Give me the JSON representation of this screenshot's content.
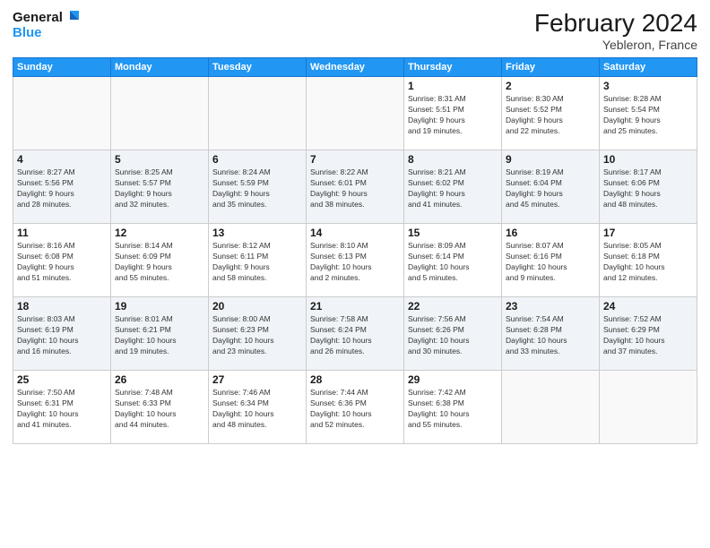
{
  "logo": {
    "line1": "General",
    "line2": "Blue"
  },
  "title": "February 2024",
  "location": "Yebleron, France",
  "days_of_week": [
    "Sunday",
    "Monday",
    "Tuesday",
    "Wednesday",
    "Thursday",
    "Friday",
    "Saturday"
  ],
  "weeks": [
    [
      {
        "day": "",
        "info": ""
      },
      {
        "day": "",
        "info": ""
      },
      {
        "day": "",
        "info": ""
      },
      {
        "day": "",
        "info": ""
      },
      {
        "day": "1",
        "info": "Sunrise: 8:31 AM\nSunset: 5:51 PM\nDaylight: 9 hours\nand 19 minutes."
      },
      {
        "day": "2",
        "info": "Sunrise: 8:30 AM\nSunset: 5:52 PM\nDaylight: 9 hours\nand 22 minutes."
      },
      {
        "day": "3",
        "info": "Sunrise: 8:28 AM\nSunset: 5:54 PM\nDaylight: 9 hours\nand 25 minutes."
      }
    ],
    [
      {
        "day": "4",
        "info": "Sunrise: 8:27 AM\nSunset: 5:56 PM\nDaylight: 9 hours\nand 28 minutes."
      },
      {
        "day": "5",
        "info": "Sunrise: 8:25 AM\nSunset: 5:57 PM\nDaylight: 9 hours\nand 32 minutes."
      },
      {
        "day": "6",
        "info": "Sunrise: 8:24 AM\nSunset: 5:59 PM\nDaylight: 9 hours\nand 35 minutes."
      },
      {
        "day": "7",
        "info": "Sunrise: 8:22 AM\nSunset: 6:01 PM\nDaylight: 9 hours\nand 38 minutes."
      },
      {
        "day": "8",
        "info": "Sunrise: 8:21 AM\nSunset: 6:02 PM\nDaylight: 9 hours\nand 41 minutes."
      },
      {
        "day": "9",
        "info": "Sunrise: 8:19 AM\nSunset: 6:04 PM\nDaylight: 9 hours\nand 45 minutes."
      },
      {
        "day": "10",
        "info": "Sunrise: 8:17 AM\nSunset: 6:06 PM\nDaylight: 9 hours\nand 48 minutes."
      }
    ],
    [
      {
        "day": "11",
        "info": "Sunrise: 8:16 AM\nSunset: 6:08 PM\nDaylight: 9 hours\nand 51 minutes."
      },
      {
        "day": "12",
        "info": "Sunrise: 8:14 AM\nSunset: 6:09 PM\nDaylight: 9 hours\nand 55 minutes."
      },
      {
        "day": "13",
        "info": "Sunrise: 8:12 AM\nSunset: 6:11 PM\nDaylight: 9 hours\nand 58 minutes."
      },
      {
        "day": "14",
        "info": "Sunrise: 8:10 AM\nSunset: 6:13 PM\nDaylight: 10 hours\nand 2 minutes."
      },
      {
        "day": "15",
        "info": "Sunrise: 8:09 AM\nSunset: 6:14 PM\nDaylight: 10 hours\nand 5 minutes."
      },
      {
        "day": "16",
        "info": "Sunrise: 8:07 AM\nSunset: 6:16 PM\nDaylight: 10 hours\nand 9 minutes."
      },
      {
        "day": "17",
        "info": "Sunrise: 8:05 AM\nSunset: 6:18 PM\nDaylight: 10 hours\nand 12 minutes."
      }
    ],
    [
      {
        "day": "18",
        "info": "Sunrise: 8:03 AM\nSunset: 6:19 PM\nDaylight: 10 hours\nand 16 minutes."
      },
      {
        "day": "19",
        "info": "Sunrise: 8:01 AM\nSunset: 6:21 PM\nDaylight: 10 hours\nand 19 minutes."
      },
      {
        "day": "20",
        "info": "Sunrise: 8:00 AM\nSunset: 6:23 PM\nDaylight: 10 hours\nand 23 minutes."
      },
      {
        "day": "21",
        "info": "Sunrise: 7:58 AM\nSunset: 6:24 PM\nDaylight: 10 hours\nand 26 minutes."
      },
      {
        "day": "22",
        "info": "Sunrise: 7:56 AM\nSunset: 6:26 PM\nDaylight: 10 hours\nand 30 minutes."
      },
      {
        "day": "23",
        "info": "Sunrise: 7:54 AM\nSunset: 6:28 PM\nDaylight: 10 hours\nand 33 minutes."
      },
      {
        "day": "24",
        "info": "Sunrise: 7:52 AM\nSunset: 6:29 PM\nDaylight: 10 hours\nand 37 minutes."
      }
    ],
    [
      {
        "day": "25",
        "info": "Sunrise: 7:50 AM\nSunset: 6:31 PM\nDaylight: 10 hours\nand 41 minutes."
      },
      {
        "day": "26",
        "info": "Sunrise: 7:48 AM\nSunset: 6:33 PM\nDaylight: 10 hours\nand 44 minutes."
      },
      {
        "day": "27",
        "info": "Sunrise: 7:46 AM\nSunset: 6:34 PM\nDaylight: 10 hours\nand 48 minutes."
      },
      {
        "day": "28",
        "info": "Sunrise: 7:44 AM\nSunset: 6:36 PM\nDaylight: 10 hours\nand 52 minutes."
      },
      {
        "day": "29",
        "info": "Sunrise: 7:42 AM\nSunset: 6:38 PM\nDaylight: 10 hours\nand 55 minutes."
      },
      {
        "day": "",
        "info": ""
      },
      {
        "day": "",
        "info": ""
      }
    ]
  ]
}
